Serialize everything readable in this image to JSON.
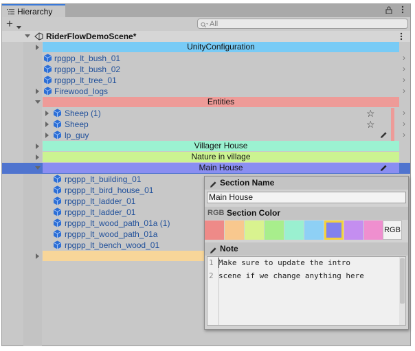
{
  "window": {
    "tab_title": "Hierarchy",
    "tab_icon": "hierarchy-list-icon",
    "tab_controls": [
      "lock-icon",
      "more-options-icon"
    ]
  },
  "toolbar": {
    "add_label": "+",
    "add_icon": "plus-dropdown-icon",
    "search_placeholder": "All",
    "search_icon": "search-filter-icon"
  },
  "scene": {
    "name": "RiderFlowDemoScene*",
    "icon": "unity-scene-icon",
    "menu_icon": "more-options-icon"
  },
  "rows": [
    {
      "label": "UnityConfiguration",
      "type": "section",
      "color": "#78cbf6"
    },
    {
      "label": "rpgpp_lt_bush_01",
      "type": "item"
    },
    {
      "label": "rpgpp_lt_bush_02",
      "type": "item"
    },
    {
      "label": "rpgpp_lt_tree_01",
      "type": "item"
    },
    {
      "label": "Firewood_logs",
      "type": "item"
    },
    {
      "label": "Entities",
      "type": "section",
      "color": "#ee9b98"
    },
    {
      "label": "Sheep (1)",
      "type": "item"
    },
    {
      "label": "Sheep",
      "type": "item"
    },
    {
      "label": "lp_guy",
      "type": "item"
    },
    {
      "label": "Villager House",
      "type": "section",
      "color": "#9bf2d1"
    },
    {
      "label": "Nature in village",
      "type": "section",
      "color": "#cbf391"
    },
    {
      "label": "Main House",
      "type": "section",
      "color": "#8a8ef1",
      "selected": true
    },
    {
      "label": "rpgpp_lt_building_01",
      "type": "item"
    },
    {
      "label": "rpgpp_lt_bird_house_01",
      "type": "item"
    },
    {
      "label": "rpgpp_lt_ladder_01",
      "type": "item"
    },
    {
      "label": "rpgpp_lt_ladder_01",
      "type": "item"
    },
    {
      "label": "rpgpp_lt_wood_path_01a (1)",
      "type": "item"
    },
    {
      "label": "rpgpp_lt_wood_path_01a",
      "type": "item"
    },
    {
      "label": "rpgpp_lt_bench_wood_01",
      "type": "item"
    },
    {
      "label": "",
      "type": "section",
      "color": "#f8d699"
    }
  ],
  "popup": {
    "section_name_header": "Section Name",
    "section_name_value": "Main House",
    "color_header_prefix": "RGB",
    "color_header": "Section Color",
    "swatches": [
      "#ee8a88",
      "#f8c88e",
      "#d9f38f",
      "#a8ee8c",
      "#9af0d0",
      "#8ed0f5",
      "#8282ec",
      "#c48ef0",
      "#ef8fcf"
    ],
    "selected_swatch": 6,
    "selected_outline": "#f3d23c",
    "rgb_button": "RGB",
    "note_header": "Note",
    "note_lines": [
      {
        "num": "1",
        "text": "Make sure to update the intro"
      },
      {
        "num": "2",
        "text": "scene if we change anything here"
      }
    ],
    "header_icon": "pencil-icon"
  }
}
